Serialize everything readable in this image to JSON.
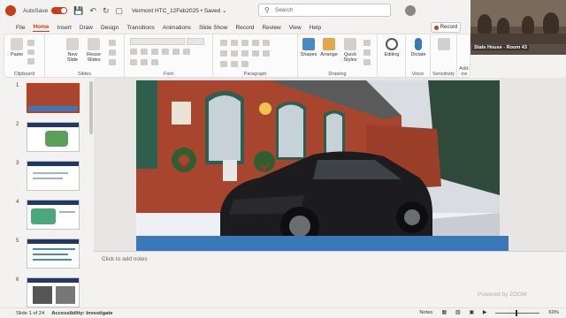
{
  "titlebar": {
    "autosave_label": "AutoSave",
    "toggle_state": "Off",
    "doc_title": "Vermont HTC_12Feb2025 • Saved ⌄",
    "search_placeholder": "Search"
  },
  "menu": [
    "File",
    "Home",
    "Insert",
    "Draw",
    "Design",
    "Transitions",
    "Animations",
    "Slide Show",
    "Record",
    "Review",
    "View",
    "Help"
  ],
  "menu_active": "Home",
  "record_label": "Record",
  "ribbon": {
    "clipboard": {
      "paste": "Paste",
      "label": "Clipboard"
    },
    "slides": {
      "new_slide": "New Slide",
      "reuse_slides": "Reuse Slides",
      "label": "Slides"
    },
    "font": {
      "label": "Font"
    },
    "paragraph": {
      "label": "Paragraph"
    },
    "drawing": {
      "shapes": "Shapes",
      "arrange": "Arrange",
      "quick_styles": "Quick Styles",
      "label": "Drawing"
    },
    "editing": {
      "label": "Editing"
    },
    "voice": {
      "dictate": "Dictate",
      "label": "Voice"
    },
    "sensitivity": {
      "label": "Sensitivity"
    },
    "addins": {
      "label": "Add-ins",
      "button": "Add-ins"
    }
  },
  "video": {
    "label": "State House - Room 43"
  },
  "thumbnails": [
    "1",
    "2",
    "3",
    "4",
    "5",
    "6"
  ],
  "notes_placeholder": "Click to add notes",
  "watermark": "Powered by ZOOM",
  "status": {
    "slide_count": "Slide 1 of 24",
    "accessibility": "Accessibility: Investigate",
    "notes": "Notes",
    "zoom": "69%"
  },
  "colors": {
    "accent": "#c43e1c",
    "band": "#3a78b9",
    "building": "#a8452e",
    "car": "#1c1c1e"
  }
}
